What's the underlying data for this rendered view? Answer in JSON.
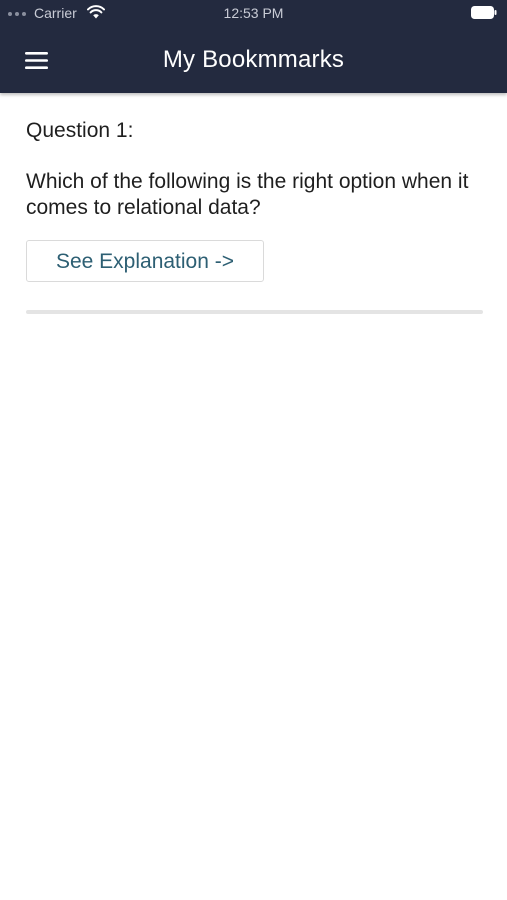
{
  "status_bar": {
    "carrier": "Carrier",
    "time": "12:53 PM",
    "icons": [
      "wifi-icon",
      "battery-icon"
    ]
  },
  "nav": {
    "title": "My Bookmmarks",
    "menu_icon": "hamburger-menu-icon"
  },
  "bookmark": {
    "heading": "Question 1:",
    "question": "Which of the following is the right option when it comes to relational data?",
    "explain_label": "See Explanation ->"
  },
  "colors": {
    "nav_background": "#232a3f",
    "nav_text": "#ffffff",
    "body_text": "#1f1f1f",
    "button_text": "#2d5f73",
    "divider": "#e4e4e4"
  }
}
